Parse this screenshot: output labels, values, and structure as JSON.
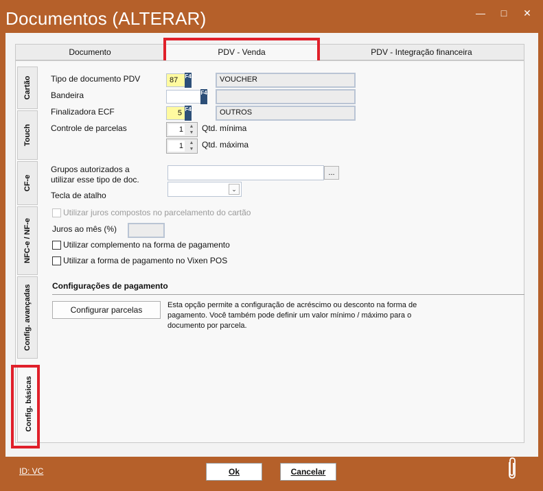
{
  "window": {
    "title": "Documentos (ALTERAR)",
    "minimize_icon": "minimize-icon",
    "maximize_icon": "maximize-icon",
    "close_icon": "close-icon"
  },
  "top_tabs": [
    {
      "label": "Documento"
    },
    {
      "label": "PDV - Venda",
      "active": true
    },
    {
      "label": "PDV - Integração financeira"
    }
  ],
  "side_tabs": [
    {
      "label": "Cartão"
    },
    {
      "label": "Touch"
    },
    {
      "label": "CF-e"
    },
    {
      "label": "NFC-e / NF-e"
    },
    {
      "label": "Config. avançadas"
    },
    {
      "label": "Config. básicas",
      "active": true
    }
  ],
  "form": {
    "tipo_documento": {
      "label": "Tipo de documento PDV",
      "code": "87",
      "description": "VOUCHER",
      "key": "F4"
    },
    "bandeira": {
      "label": "Bandeira",
      "code": "",
      "description": "",
      "key": "F4"
    },
    "finalizadora": {
      "label": "Finalizadora ECF",
      "code": "5",
      "description": "OUTROS",
      "key": "F4"
    },
    "parcelas": {
      "label": "Controle de parcelas",
      "min_value": "1",
      "min_label": "Qtd. mínima",
      "max_value": "1",
      "max_label": "Qtd. máxima"
    },
    "grupos": {
      "label_line1": "Grupos autorizados a",
      "label_line2": "utilizar esse tipo de doc.",
      "value": "",
      "button": "..."
    },
    "tecla_atalho": {
      "label": "Tecla de atalho",
      "value": ""
    },
    "juros_compostos": {
      "label": "Utilizar juros compostos no parcelamento do cartão",
      "checked": false,
      "enabled": false
    },
    "juros_mes": {
      "label": "Juros ao mês (%)",
      "value": ""
    },
    "complemento": {
      "label": "Utilizar complemento na forma de pagamento",
      "checked": false
    },
    "vixen_pos": {
      "label": "Utilizar a forma de pagamento no Vixen POS",
      "checked": false
    }
  },
  "pagamento": {
    "title": "Configurações de pagamento",
    "button": "Configurar parcelas",
    "description_lines": [
      "Esta opção permite a configuração de acréscimo ou desconto na forma de",
      "pagamento. Você também pode definir um valor mínimo / máximo para o",
      "documento por parcela."
    ]
  },
  "footer": {
    "id_link": "ID: VC",
    "ok": "Ok",
    "cancel": "Cancelar",
    "attach_icon": "paperclip-icon"
  },
  "colors": {
    "window_bg": "#b5602a",
    "highlight_red": "#e0202a",
    "required_yellow": "#fffaa0",
    "f4_blue": "#2d4f78"
  }
}
